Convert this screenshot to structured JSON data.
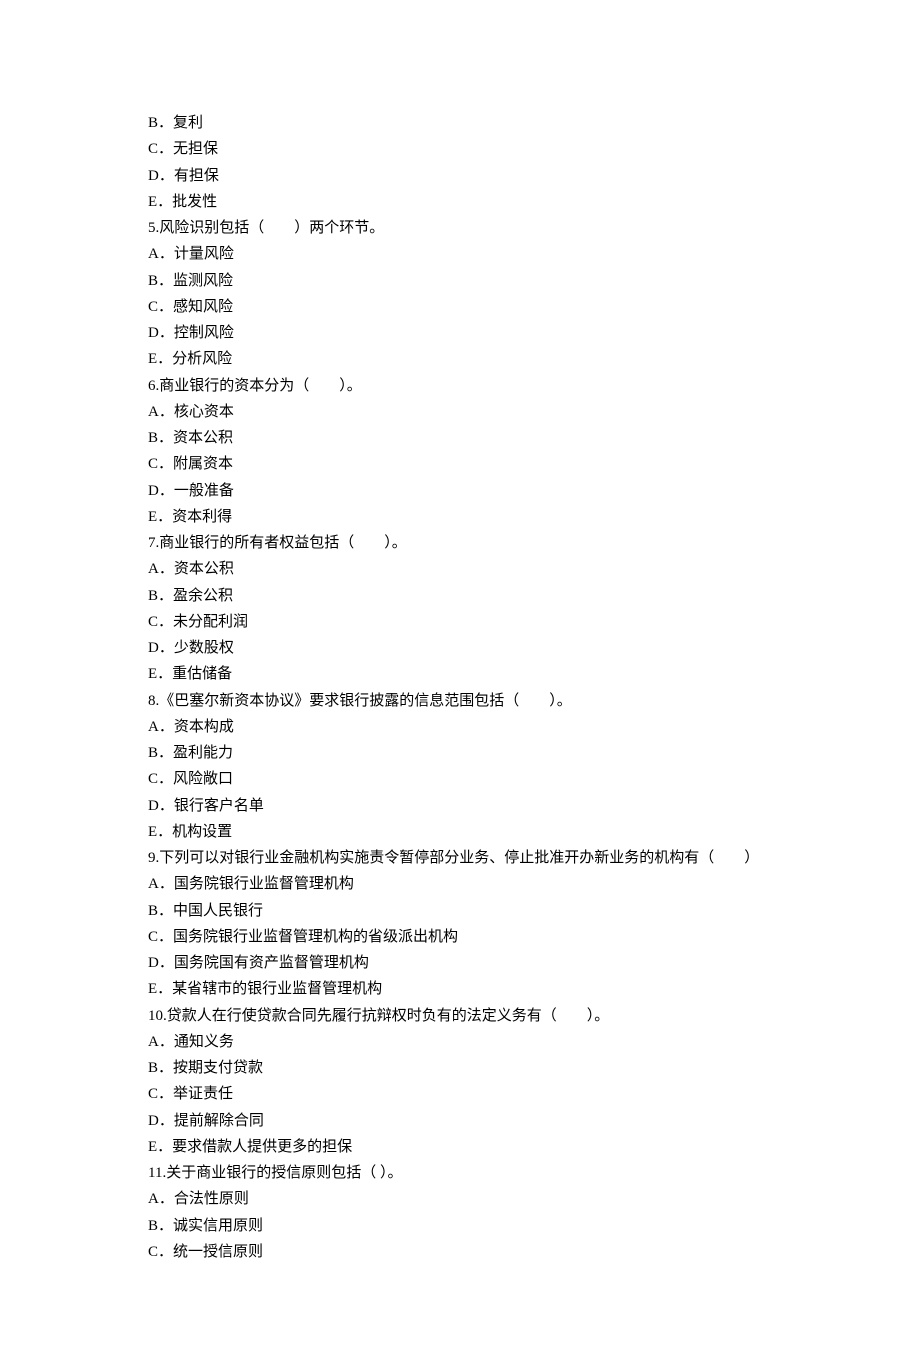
{
  "lines": [
    "B．复利",
    "C．无担保",
    "D．有担保",
    "E．批发性",
    "5.风险识别包括（　　）两个环节。",
    "A．计量风险",
    "B．监测风险",
    "C．感知风险",
    "D．控制风险",
    "E．分析风险",
    "6.商业银行的资本分为（　　）。",
    "A．核心资本",
    "B．资本公积",
    "C．附属资本",
    "D．一般准备",
    "E．资本利得",
    "7.商业银行的所有者权益包括（　　）。",
    "A．资本公积",
    "B．盈余公积",
    "C．未分配利润",
    "D．少数股权",
    "E．重估储备",
    "8.《巴塞尔新资本协议》要求银行披露的信息范围包括（　　）。",
    "A．资本构成",
    "B．盈利能力",
    "C．风险敞口",
    "D．银行客户名单",
    "E．机构设置",
    "9.下列可以对银行业金融机构实施责令暂停部分业务、停止批准开办新业务的机构有（　　）",
    "A．国务院银行业监督管理机构",
    "B．中国人民银行",
    "C．国务院银行业监督管理机构的省级派出机构",
    "D．国务院国有资产监督管理机构",
    "E．某省辖市的银行业监督管理机构",
    "10.贷款人在行使贷款合同先履行抗辩权时负有的法定义务有（　　）。",
    "A．通知义务",
    "B．按期支付贷款",
    "C．举证责任",
    "D．提前解除合同",
    "E．要求借款人提供更多的担保",
    "11.关于商业银行的授信原则包括（ ）。",
    "A．合法性原则",
    "B．诚实信用原则",
    "C．统一授信原则"
  ]
}
